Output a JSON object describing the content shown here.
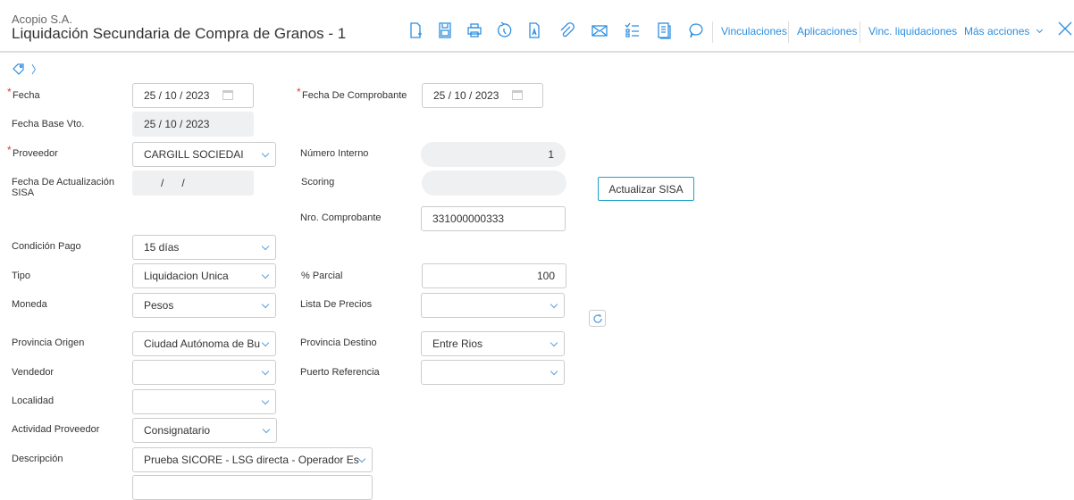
{
  "header": {
    "company": "Acopio S.A.",
    "title": "Liquidación Secundaria de Compra de Granos - 1"
  },
  "toolbar": {
    "icons": [
      "new-document-icon",
      "save-icon",
      "print-icon",
      "history-icon",
      "pdf-icon",
      "attach-icon",
      "email-icon",
      "checklist-icon",
      "document-icon",
      "comment-icon"
    ],
    "links": [
      "Vinculaciones",
      "Aplicaciones",
      "Vinc. liquidaciones",
      "Más acciones"
    ]
  },
  "form": {
    "fecha": {
      "label": "Fecha",
      "value": "25 / 10 / 2023"
    },
    "fecha_comprobante": {
      "label": "Fecha De Comprobante",
      "value": "25 / 10 / 2023"
    },
    "fecha_base_vto": {
      "label": "Fecha Base Vto.",
      "value": "25 / 10 / 2023"
    },
    "proveedor": {
      "label": "Proveedor",
      "value": "CARGILL SOCIEDAI"
    },
    "numero_interno": {
      "label": "Número Interno",
      "value": "1"
    },
    "fecha_act_sisa": {
      "label": "Fecha De Actualización SISA",
      "value": "/      /"
    },
    "scoring": {
      "label": "Scoring",
      "value": ""
    },
    "actualizar_sisa": "Actualizar SISA",
    "nro_comprobante": {
      "label": "Nro. Comprobante",
      "value": "331000000333"
    },
    "condicion_pago": {
      "label": "Condición Pago",
      "value": "15 días"
    },
    "tipo": {
      "label": "Tipo",
      "value": "Liquidacion Unica"
    },
    "parcial": {
      "label": "% Parcial",
      "value": "100"
    },
    "moneda": {
      "label": "Moneda",
      "value": "Pesos"
    },
    "lista_precios": {
      "label": "Lista De Precios",
      "value": ""
    },
    "provincia_origen": {
      "label": "Provincia Origen",
      "value": "Ciudad Autónoma de Bu"
    },
    "provincia_destino": {
      "label": "Provincia Destino",
      "value": "Entre Rios"
    },
    "vendedor": {
      "label": "Vendedor",
      "value": ""
    },
    "puerto_referencia": {
      "label": "Puerto Referencia",
      "value": ""
    },
    "localidad": {
      "label": "Localidad",
      "value": ""
    },
    "actividad_proveedor": {
      "label": "Actividad Proveedor",
      "value": "Consignatario"
    },
    "descripcion": {
      "label": "Descripción",
      "value": "Prueba SICORE - LSG directa - Operador Es"
    }
  }
}
